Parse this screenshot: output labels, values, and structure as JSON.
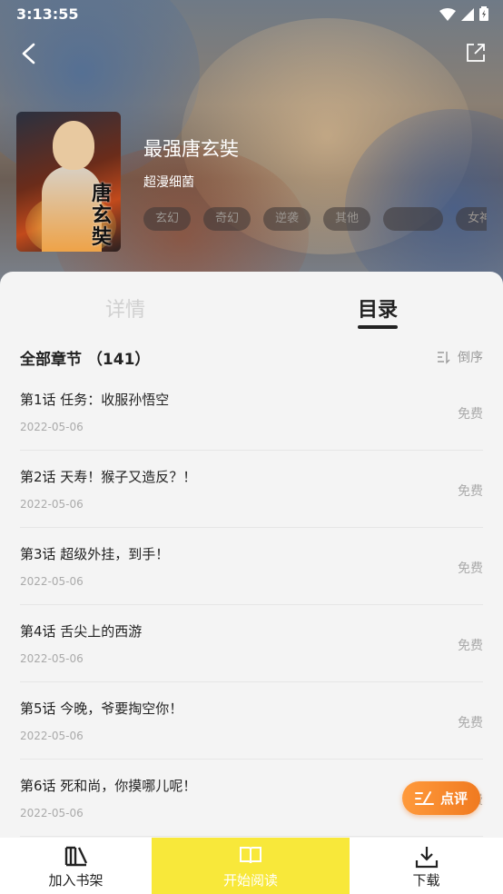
{
  "status_bar": {
    "time": "3:13:55"
  },
  "header": {
    "back_icon": "chevron-left-icon",
    "share_icon": "share-icon"
  },
  "book": {
    "title": "最强唐玄奘",
    "author": "超漫细菌",
    "tags": [
      "玄幻",
      "奇幻",
      "逆袭",
      "其他",
      "",
      "女神"
    ],
    "cover_text": "唐玄奘"
  },
  "tabs": [
    {
      "label": "详情",
      "active": false
    },
    {
      "label": "目录",
      "active": true
    }
  ],
  "catalog": {
    "title": "全部章节",
    "count": "（141）",
    "order_label": "倒序",
    "order_icon": "sort-icon"
  },
  "chapters": [
    {
      "title": "第1话 任务：收服孙悟空",
      "date": "2022-05-06",
      "price": "免费"
    },
    {
      "title": "第2话 天寿！猴子又造反？！",
      "date": "2022-05-06",
      "price": "免费"
    },
    {
      "title": "第3话 超级外挂，到手！",
      "date": "2022-05-06",
      "price": "免费"
    },
    {
      "title": "第4话 舌尖上的西游",
      "date": "2022-05-06",
      "price": "免费"
    },
    {
      "title": "第5话 今晚，爷要掏空你！",
      "date": "2022-05-06",
      "price": "免费"
    },
    {
      "title": "第6话 死和尚，你摸哪儿呢！",
      "date": "2022-05-06",
      "price": "免费"
    }
  ],
  "review_button": {
    "label": "点评",
    "icon": "edit-icon"
  },
  "bottom_bar": {
    "shelf": {
      "label": "加入书架",
      "icon": "bookshelf-icon"
    },
    "read": {
      "label": "开始阅读",
      "icon": "open-book-icon"
    },
    "download": {
      "label": "下载",
      "icon": "download-icon"
    }
  },
  "colors": {
    "accent_yellow": "#f8e83a",
    "review_orange": "#f07a20"
  }
}
